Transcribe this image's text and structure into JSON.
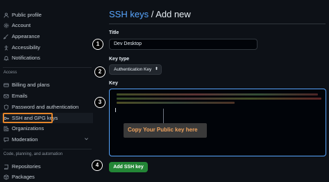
{
  "sidebar": {
    "items_top": [
      {
        "label": "Public profile",
        "icon": "person-icon"
      },
      {
        "label": "Account",
        "icon": "gear-icon"
      },
      {
        "label": "Appearance",
        "icon": "paintbrush-icon"
      },
      {
        "label": "Accessibility",
        "icon": "accessibility-icon"
      },
      {
        "label": "Notifications",
        "icon": "bell-icon"
      }
    ],
    "access_label": "Access",
    "items_access": [
      {
        "label": "Billing and plans",
        "icon": "credit-card-icon"
      },
      {
        "label": "Emails",
        "icon": "mail-icon"
      },
      {
        "label": "Password and authentication",
        "icon": "shield-lock-icon"
      },
      {
        "label": "SSH and GPG keys",
        "icon": "key-icon",
        "active": true
      },
      {
        "label": "Organizations",
        "icon": "organization-icon"
      },
      {
        "label": "Moderation",
        "icon": "report-icon"
      }
    ],
    "automation_label": "Code, planning, and automation",
    "items_automation": [
      {
        "label": "Repositories",
        "icon": "repo-icon"
      },
      {
        "label": "Packages",
        "icon": "package-icon"
      }
    ]
  },
  "main": {
    "title_link": "SSH keys",
    "title_rest": " / Add new",
    "title_field_label": "Title",
    "title_value": "Dev Desktop",
    "key_type_label": "Key type",
    "key_type_value": "Authentication Key",
    "key_label": "Key",
    "tooltip": "Copy Your Public key here",
    "add_button": "Add SSH key"
  },
  "badges": [
    "1",
    "2",
    "3",
    "4"
  ],
  "colors": {
    "background": "#0d1117",
    "link": "#58a6ff",
    "button_green": "#238636",
    "highlight_orange": "#e7862a"
  }
}
